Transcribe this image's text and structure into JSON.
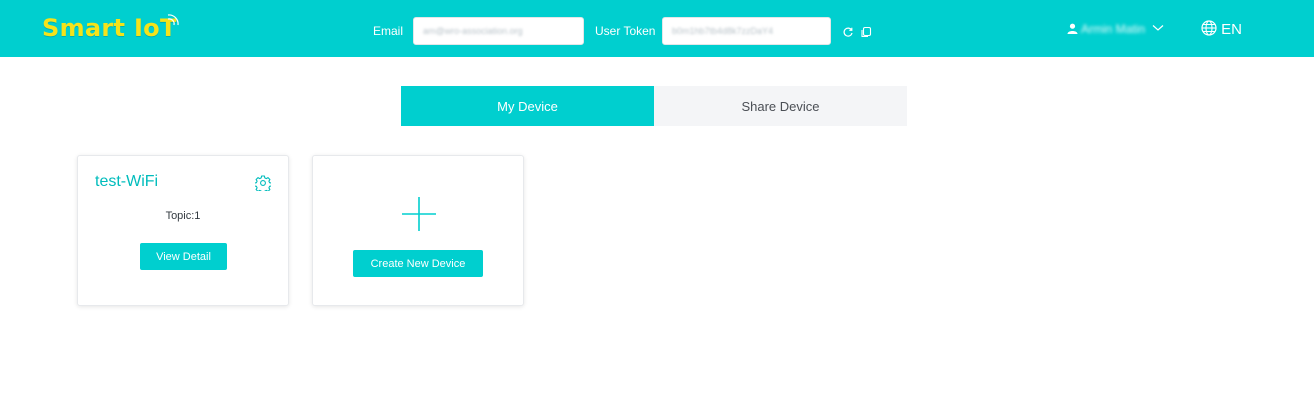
{
  "header": {
    "logo": "Smart IoT",
    "email_label": "Email",
    "email_value": "am@wro-association.org",
    "token_label": "User Token",
    "token_value": "b0m1hb7tb4d8k7zzDaY4",
    "user_name": "Armin Matin",
    "language": "EN"
  },
  "tabs": [
    {
      "label": "My Device"
    },
    {
      "label": "Share Device"
    }
  ],
  "devices": [
    {
      "name": "test-WiFi",
      "topic": "Topic:1",
      "button": "View Detail"
    }
  ],
  "create_card": {
    "button": "Create New Device"
  },
  "colors": {
    "accent": "#00cfcf",
    "logo": "#f4e31a"
  }
}
